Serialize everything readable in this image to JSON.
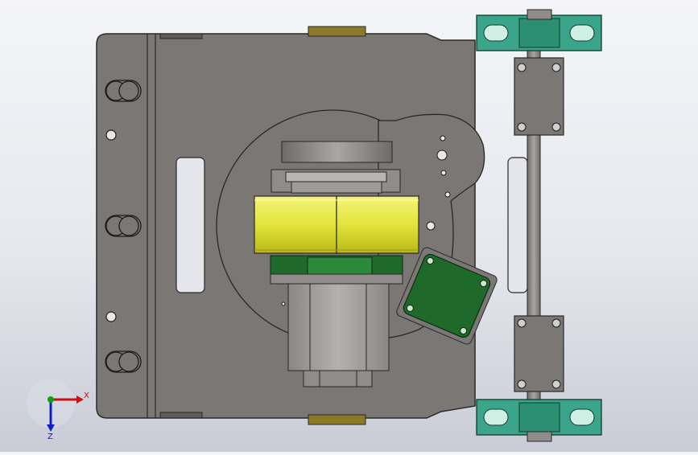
{
  "viewport": {
    "background_top": "#f4f5f8",
    "background_bottom": "#c9ccd6"
  },
  "colors": {
    "base_plate": "#7a7774",
    "base_plate_dark": "#5f5c59",
    "motor_yellow": "#e8e840",
    "motor_yellow_shade": "#c8c822",
    "green_part": "#1f6a2a",
    "bearing_green": "#3aa58a",
    "axis_x": "#d01010",
    "axis_y": "#10a010",
    "axis_z": "#1020c0"
  },
  "triad": {
    "x_label": "X",
    "z_label": "Z"
  }
}
